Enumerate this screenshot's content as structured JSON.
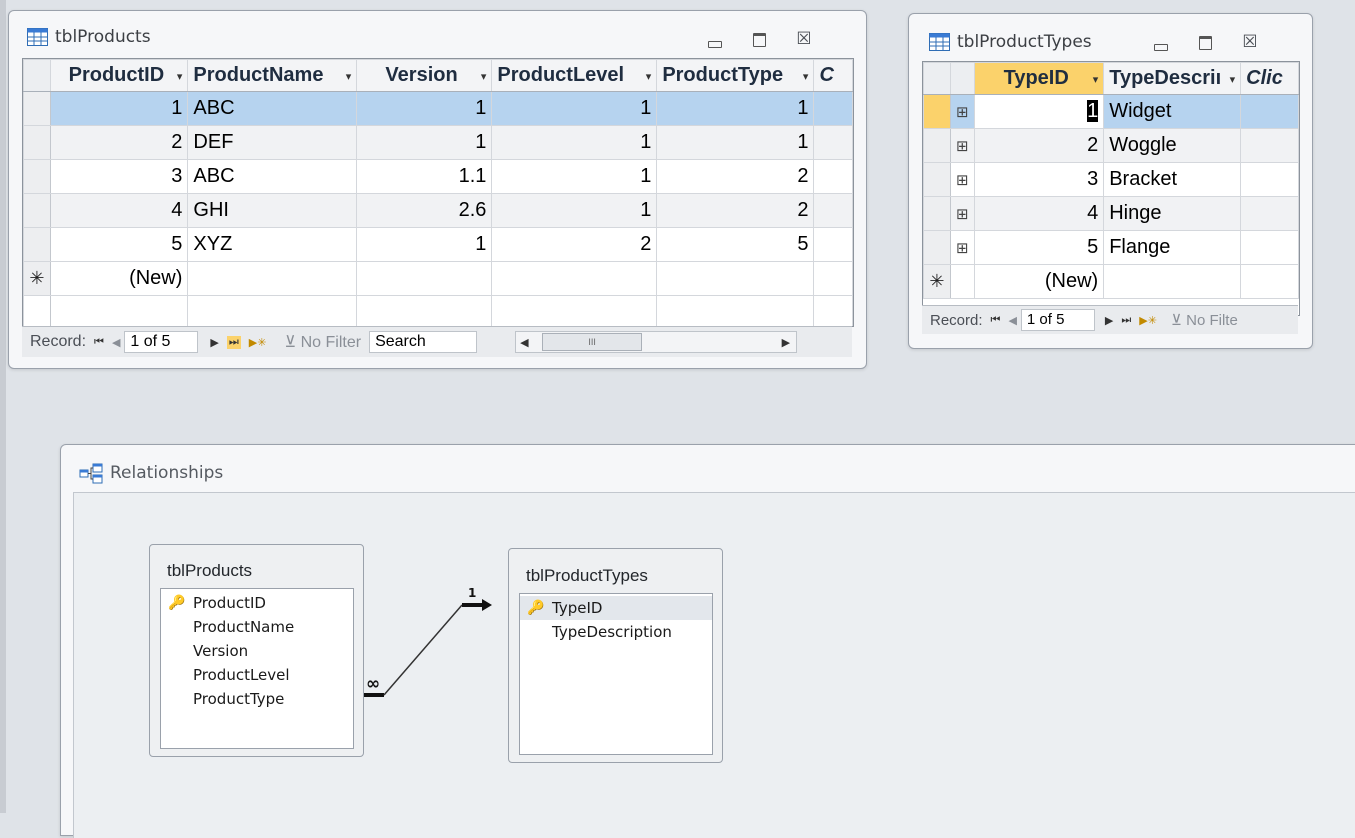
{
  "products_window": {
    "title": "tblProducts",
    "icon": "table-icon",
    "columns": [
      "ProductID",
      "ProductName",
      "Version",
      "ProductLevel",
      "ProductType",
      "C"
    ],
    "rows": [
      {
        "ProductID": "1",
        "ProductName": "ABC",
        "Version": "1",
        "ProductLevel": "1",
        "ProductType": "1"
      },
      {
        "ProductID": "2",
        "ProductName": "DEF",
        "Version": "1",
        "ProductLevel": "1",
        "ProductType": "1"
      },
      {
        "ProductID": "3",
        "ProductName": "ABC",
        "Version": "1.1",
        "ProductLevel": "1",
        "ProductType": "2"
      },
      {
        "ProductID": "4",
        "ProductName": "GHI",
        "Version": "2.6",
        "ProductLevel": "1",
        "ProductType": "2"
      },
      {
        "ProductID": "5",
        "ProductName": "XYZ",
        "Version": "1",
        "ProductLevel": "2",
        "ProductType": "5"
      }
    ],
    "new_row_label": "(New)",
    "new_row_marker": "✳",
    "nav": {
      "record_label": "Record:",
      "position": "1 of 5",
      "filter_label": "No Filter",
      "search_label": "Search",
      "scroll_thumb": "III"
    }
  },
  "types_window": {
    "title": "tblProductTypes",
    "icon": "table-icon",
    "columns": [
      "TypeID",
      "TypeDescriı",
      "Clic"
    ],
    "rows": [
      {
        "TypeID": "1",
        "TypeDescription": "Widget"
      },
      {
        "TypeID": "2",
        "TypeDescription": "Woggle"
      },
      {
        "TypeID": "3",
        "TypeDescription": "Bracket"
      },
      {
        "TypeID": "4",
        "TypeDescription": "Hinge"
      },
      {
        "TypeID": "5",
        "TypeDescription": "Flange"
      }
    ],
    "expand_glyph": "⊞",
    "new_row_label": "(New)",
    "new_row_marker": "✳",
    "nav": {
      "record_label": "Record:",
      "position": "1 of 5",
      "filter_label": "No Filte"
    }
  },
  "relationships_window": {
    "title": "Relationships",
    "icon": "relationships-icon",
    "products_table": {
      "title": "tblProducts",
      "fields": [
        {
          "name": "ProductID",
          "key": true
        },
        {
          "name": "ProductName",
          "key": false
        },
        {
          "name": "Version",
          "key": false
        },
        {
          "name": "ProductLevel",
          "key": false
        },
        {
          "name": "ProductType",
          "key": false
        }
      ]
    },
    "types_table": {
      "title": "tblProductTypes",
      "fields": [
        {
          "name": "TypeID",
          "key": true
        },
        {
          "name": "TypeDescription",
          "key": false
        }
      ]
    },
    "join": {
      "one_label": "1",
      "many_label": "∞"
    }
  },
  "glyphs": {
    "dropdown": "▾",
    "close": "☒",
    "key": "🔑",
    "nav_first": "⏮",
    "nav_prev": "◀",
    "nav_next": "▶",
    "nav_last": "⏭",
    "nav_new": "▶✳"
  },
  "colors": {
    "selected_row": "#b6d3ef",
    "current_cell_header": "#fbd26b",
    "window_bg": "#f6f7f9"
  }
}
